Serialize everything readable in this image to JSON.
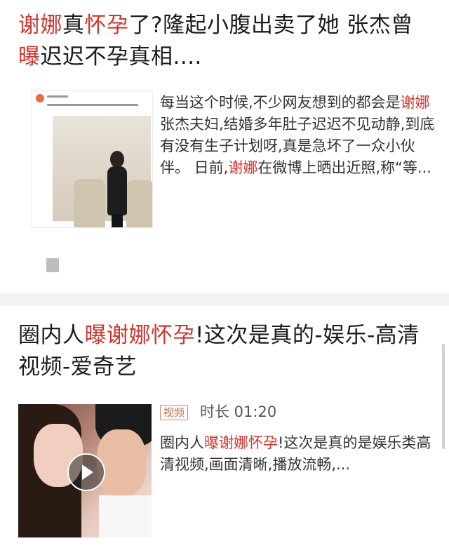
{
  "results": [
    {
      "title_parts": [
        {
          "text": "谢娜",
          "highlight": true
        },
        {
          "text": "真",
          "highlight": false
        },
        {
          "text": "怀孕",
          "highlight": true
        },
        {
          "text": "了?隆起小腹出卖了她 张杰曾",
          "highlight": false
        },
        {
          "text": "曝",
          "highlight": true
        },
        {
          "text": "迟迟不孕真相....",
          "highlight": false
        }
      ],
      "excerpt_parts": [
        {
          "text": "每当这个时候,不少网友想到的都会是",
          "highlight": false
        },
        {
          "text": "谢娜",
          "highlight": true
        },
        {
          "text": "张杰夫妇,结婚多年肚子迟迟不见动静,到底有没有生子计划呀,真是急坏了一众小伙伴。 日前,",
          "highlight": false
        },
        {
          "text": "谢娜",
          "highlight": true
        },
        {
          "text": "在微博上晒出近照,称“等...",
          "highlight": false
        }
      ]
    },
    {
      "title_parts": [
        {
          "text": "圈内人",
          "highlight": false
        },
        {
          "text": "曝谢娜怀孕",
          "highlight": true
        },
        {
          "text": "!这次是真的-娱乐-高清视频-爱奇艺",
          "highlight": false
        }
      ],
      "video_tag": "视频",
      "duration": "时长 01:20",
      "excerpt_parts": [
        {
          "text": "圈内人",
          "highlight": false
        },
        {
          "text": "曝谢娜怀孕",
          "highlight": true
        },
        {
          "text": "!这次是真的是娱乐类高清视频,画面清晰,播放流畅,...",
          "highlight": false
        }
      ]
    }
  ],
  "colors": {
    "highlight": "#d1362f",
    "separator": "#f2f2f2",
    "video_tag": "#d06a45"
  },
  "icons": [
    "play-icon"
  ]
}
